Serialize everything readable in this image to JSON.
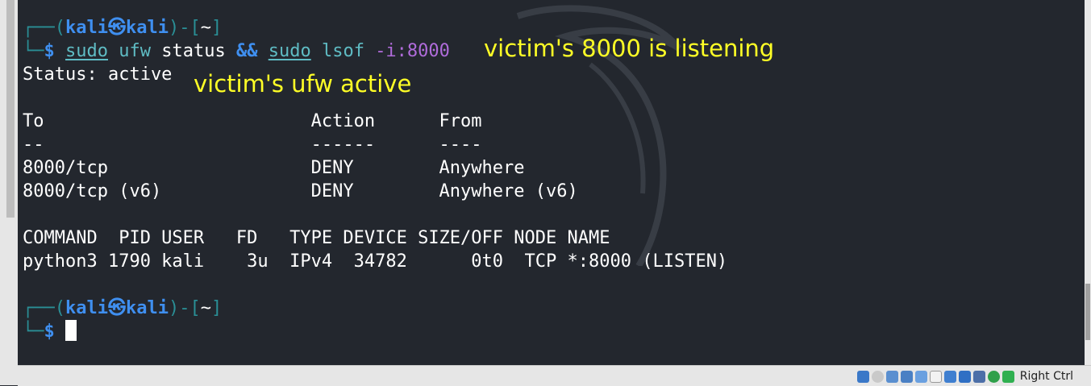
{
  "terminal": {
    "prompt": {
      "top_prefix": "┌──(",
      "user": "kali",
      "at_symbol": "㉿",
      "host": "kali",
      "bracket_mid": ")-[",
      "cwd": "~",
      "bracket_end": "]",
      "bottom_prefix": "└─",
      "dollar": "$"
    },
    "command": {
      "sudo1": "sudo",
      "part1": "ufw",
      "part2": "status",
      "and_op": "&&",
      "sudo2": "sudo",
      "part3": "lsof",
      "part4": "-i:8000"
    },
    "output": {
      "status_line": "Status: active",
      "ufw_header": "To                         Action      From",
      "ufw_sep": "--                         ------      ----",
      "ufw_row1": "8000/tcp                   DENY        Anywhere",
      "ufw_row2": "8000/tcp (v6)              DENY        Anywhere (v6)",
      "lsof_header": "COMMAND  PID USER   FD   TYPE DEVICE SIZE/OFF NODE NAME",
      "lsof_row1": "python3 1790 kali    3u  IPv4  34782      0t0  TCP *:8000 (LISTEN)"
    },
    "annotations": {
      "listening": "victim's 8000 is listening",
      "ufw_active": "victim's ufw active"
    }
  },
  "statusbar": {
    "host_key": "Right Ctrl",
    "tray_icons": [
      "hdd-icon",
      "optical-disc-icon",
      "audio-icon",
      "network-icon",
      "usb-icon",
      "shared-folder-icon",
      "display-icon",
      "recording-icon",
      "cpu-icon",
      "mouse-integration-icon",
      "download-icon"
    ]
  },
  "colors": {
    "terminal_bg": "#23272e",
    "prompt_user": "#3f8ff0",
    "prompt_frame": "#2a8f96",
    "annotation": "#ffff26",
    "arg": "#b06cdb"
  }
}
